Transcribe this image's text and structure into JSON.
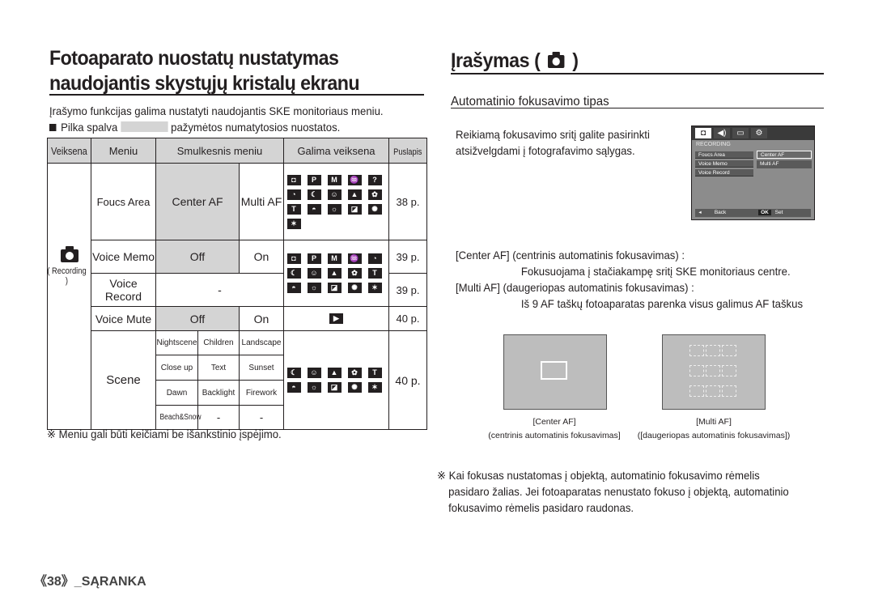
{
  "left": {
    "title": "Fotoaparato nuostatų nustatymas naudojantis skystųjų kristalų ekranu",
    "intro_line1": "Įrašymo funkcijas galima nustatyti naudojantis SKE monitoriaus meniu.",
    "intro_line2_pre": "Pilka spalva",
    "intro_line2_post": "pažymėtos numatytosios nuostatos.",
    "table": {
      "headers": [
        "Veiksena",
        "Meniu",
        "Smulkesnis meniu",
        "Galima veiksena",
        "Puslapis"
      ],
      "mode_label": "( Recording )",
      "rows": {
        "focus": {
          "menu": "Foucs Area",
          "opt1": "Center AF",
          "opt2": "Multi AF",
          "page": "38 p."
        },
        "voice_memo": {
          "menu": "Voice Memo",
          "opt1": "Off",
          "opt2": "On",
          "page": "39 p."
        },
        "voice_record": {
          "menu": "Voice Record",
          "opt": "-",
          "page": "39 p."
        },
        "voice_mute": {
          "menu": "Voice Mute",
          "opt1": "Off",
          "opt2": "On",
          "page": "40 p."
        },
        "scene": {
          "menu": "Scene",
          "options": [
            [
              "Nightscene",
              "Children",
              "Landscape"
            ],
            [
              "Close up",
              "Text",
              "Sunset"
            ],
            [
              "Dawn",
              "Backlight",
              "Firework"
            ],
            [
              "Beach&Snow",
              "-",
              "-"
            ]
          ],
          "page": "40 p."
        }
      },
      "mode_icons_focus": [
        "camera-icon",
        "program-icon",
        "M",
        "dual-is-icon",
        "photo-help-icon",
        "portrait-icon",
        "nightscene-icon",
        "children-icon",
        "landscape-icon",
        "closeup-icon",
        "T",
        "sunset-icon",
        "dawn-icon",
        "backlight-icon",
        "firework-icon",
        "beach-snow-icon"
      ],
      "mode_icons_voice": [
        "camera-icon",
        "program-icon",
        "M",
        "dual-is-icon",
        "portrait-icon",
        "nightscene-icon",
        "children-icon",
        "landscape-icon",
        "closeup-icon",
        "T",
        "sunset-icon",
        "dawn-icon",
        "backlight-icon",
        "firework-icon",
        "beach-snow-icon"
      ],
      "mode_icons_mute": [
        "movie-icon"
      ],
      "mode_icons_scene": [
        "nightscene-icon",
        "children-icon",
        "landscape-icon",
        "closeup-icon",
        "T",
        "sunset-icon",
        "dawn-icon",
        "backlight-icon",
        "firework-icon",
        "beach-snow-icon"
      ]
    },
    "note": "※ Meniu gali būti keičiami be išankstinio įspėjimo.",
    "footer": "《38》_SĄRANKA"
  },
  "right": {
    "title_pre": "Įrašymas (",
    "title_post": ")",
    "subtitle": "Automatinio fokusavimo tipas",
    "para_line1": "Reikiamą fokusavimo sritį galite pasirinkti",
    "para_line2": "atsižvelgdami į fotografavimo sąlygas.",
    "lcd": {
      "section": "RECORDING",
      "items": [
        "Foucs Area",
        "Voice Memo",
        "Voice Record"
      ],
      "sub_items": [
        "Center AF",
        "Multi AF"
      ],
      "back_label": "Back",
      "ok_key": "OK",
      "set_label": "Set"
    },
    "desc": {
      "center_head": "[Center AF] (centrinis automatinis fokusavimas) :",
      "center_body": "Fokusuojama į stačiakampę sritį SKE monitoriaus centre.",
      "multi_head": "[Multi AF] (daugeriopas automatinis fokusavimas) :",
      "multi_body": "Iš 9 AF taškų fotoaparatas parenka visus galimus AF taškus"
    },
    "captions": {
      "center_1": "[Center AF]",
      "center_2": "(centrinis automatinis fokusavimas]",
      "multi_1": "[Multi AF]",
      "multi_2": "([daugeriopas automatinis fokusavimas])"
    },
    "note_line1": "※ Kai fokusas nustatomas į objektą, automatinio fokusavimo rėmelis",
    "note_line2": "pasidaro žalias. Jei fotoaparatas nenustato fokuso į objektą, automatinio",
    "note_line3": "fokusavimo rėmelis pasidaro raudonas."
  }
}
